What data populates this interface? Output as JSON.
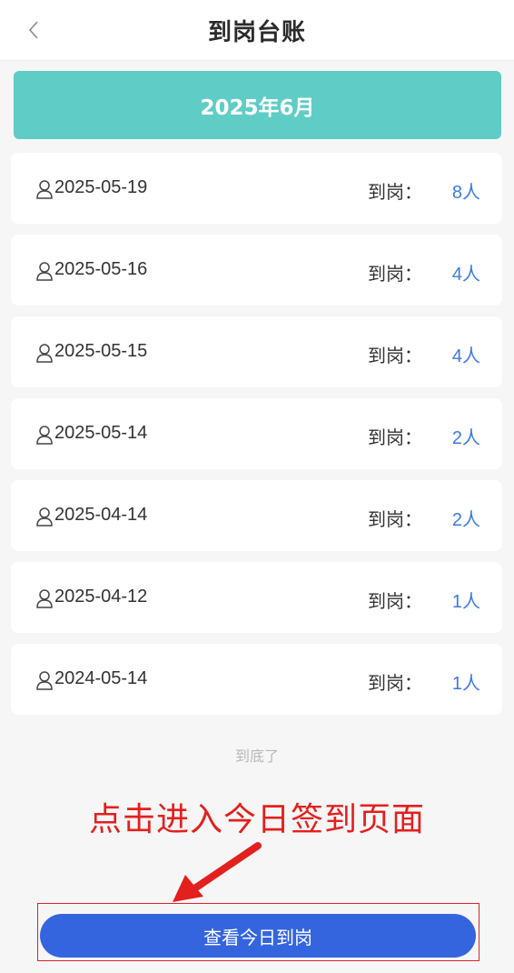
{
  "header": {
    "title": "到岗台账",
    "back_icon": "chevron-left-icon"
  },
  "month_banner": {
    "label": "2025年6月"
  },
  "records": [
    {
      "date": "2025-05-19",
      "count_label": "到岗：",
      "count": "8人"
    },
    {
      "date": "2025-05-16",
      "count_label": "到岗：",
      "count": "4人"
    },
    {
      "date": "2025-05-15",
      "count_label": "到岗：",
      "count": "4人"
    },
    {
      "date": "2025-05-14",
      "count_label": "到岗：",
      "count": "2人"
    },
    {
      "date": "2025-04-14",
      "count_label": "到岗：",
      "count": "2人"
    },
    {
      "date": "2025-04-12",
      "count_label": "到岗：",
      "count": "1人"
    },
    {
      "date": "2024-05-14",
      "count_label": "到岗：",
      "count": "1人"
    }
  ],
  "list_end_text": "到底了",
  "annotation_text": "点击进入今日签到页面",
  "primary_button": {
    "label": "查看今日到岗"
  },
  "colors": {
    "banner": "#5fcdc6",
    "count": "#3d7ae3",
    "button": "#3465df",
    "annotation": "#e3201e"
  }
}
